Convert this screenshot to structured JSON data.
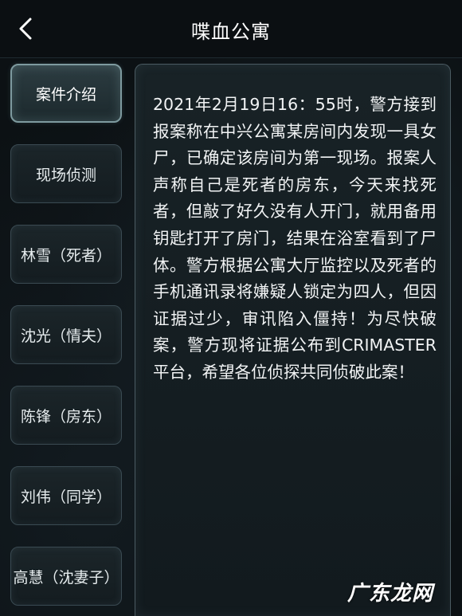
{
  "header": {
    "title": "喋血公寓",
    "back_icon": "chevron-left-icon"
  },
  "sidebar": {
    "items": [
      {
        "label": "案件介绍",
        "active": true
      },
      {
        "label": "现场侦测",
        "active": false
      },
      {
        "label": "林雪（死者）",
        "active": false
      },
      {
        "label": "沈光（情夫）",
        "active": false
      },
      {
        "label": "陈锋（房东）",
        "active": false
      },
      {
        "label": "刘伟（同学）",
        "active": false
      },
      {
        "label": "高慧（沈妻子）",
        "active": false
      }
    ]
  },
  "content": {
    "text": "2021年2月19日16：55时，警方接到报案称在中兴公寓某房间内发现一具女尸，已确定该房间为第一现场。报案人声称自己是死者的房东，今天来找死者，但敲了好久没有人开门，就用备用钥匙打开了房门，结果在浴室看到了尸体。警方根据公寓大厅监控以及死者的手机通讯录将嫌疑人锁定为四人，但因证据过少，审讯陷入僵持！为尽快破案，警方现将证据公布到CRIMASTER平台，希望各位侦探共同侦破此案！"
  },
  "watermark": {
    "text": "广东龙网"
  },
  "colors": {
    "background": "#0c1114",
    "panel_border": "#4b5b62",
    "active_border": "#7e9a9f",
    "text": "#f2f4f5"
  }
}
